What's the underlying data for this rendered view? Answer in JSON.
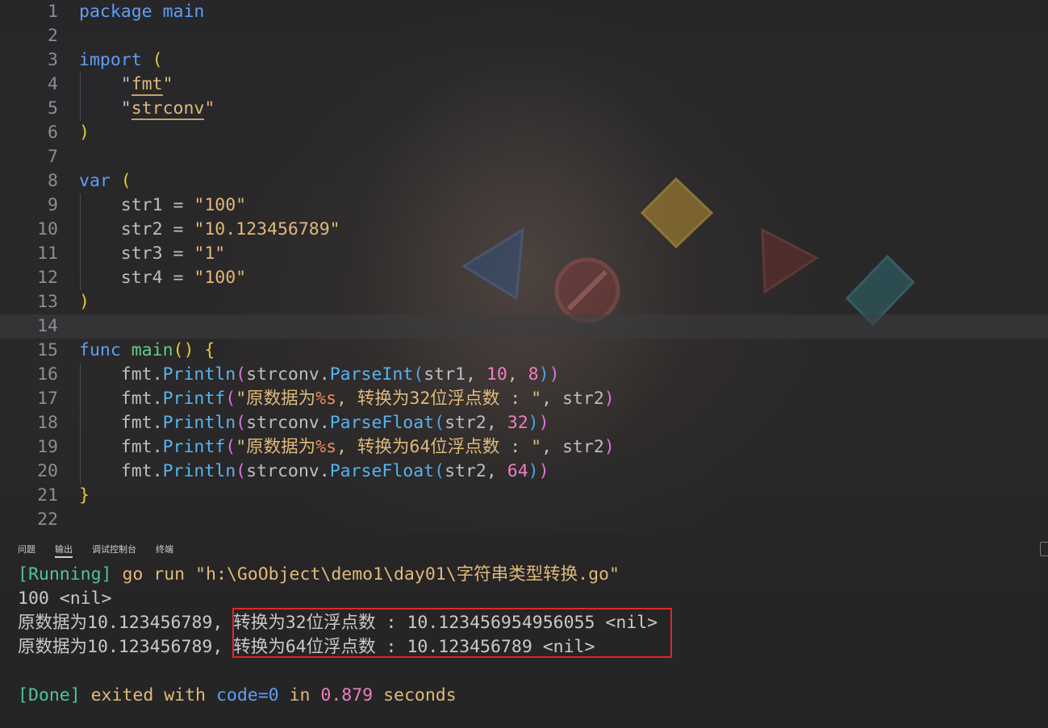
{
  "editor": {
    "lines": [
      {
        "n": "1",
        "tokens": [
          {
            "t": "package",
            "c": "kw"
          },
          {
            "t": " "
          },
          {
            "t": "main",
            "c": "kw"
          }
        ]
      },
      {
        "n": "2",
        "tokens": []
      },
      {
        "n": "3",
        "tokens": [
          {
            "t": "import",
            "c": "kw"
          },
          {
            "t": " "
          },
          {
            "t": "(",
            "c": "pl"
          }
        ]
      },
      {
        "n": "4",
        "tokens": [
          {
            "t": "    \""
          },
          {
            "t": "fmt",
            "c": "str ul"
          },
          {
            "t": "\"",
            "c": "str"
          }
        ]
      },
      {
        "n": "5",
        "tokens": [
          {
            "t": "    \""
          },
          {
            "t": "strconv",
            "c": "str ul"
          },
          {
            "t": "\"",
            "c": "str"
          }
        ]
      },
      {
        "n": "6",
        "tokens": [
          {
            "t": ")",
            "c": "pl"
          }
        ]
      },
      {
        "n": "7",
        "tokens": []
      },
      {
        "n": "8",
        "tokens": [
          {
            "t": "var",
            "c": "kw"
          },
          {
            "t": " "
          },
          {
            "t": "(",
            "c": "pl"
          }
        ]
      },
      {
        "n": "9",
        "tokens": [
          {
            "t": "    str1 = "
          },
          {
            "t": "\"100\"",
            "c": "str"
          }
        ]
      },
      {
        "n": "10",
        "tokens": [
          {
            "t": "    str2 = "
          },
          {
            "t": "\"10.123456789\"",
            "c": "str"
          }
        ]
      },
      {
        "n": "11",
        "tokens": [
          {
            "t": "    str3 = "
          },
          {
            "t": "\"1\"",
            "c": "str"
          }
        ]
      },
      {
        "n": "12",
        "tokens": [
          {
            "t": "    str4 = "
          },
          {
            "t": "\"100\"",
            "c": "str"
          }
        ]
      },
      {
        "n": "13",
        "tokens": [
          {
            "t": ")",
            "c": "pl"
          }
        ]
      },
      {
        "n": "14",
        "tokens": [],
        "current": true
      },
      {
        "n": "15",
        "tokens": [
          {
            "t": "func",
            "c": "kw"
          },
          {
            "t": " "
          },
          {
            "t": "main",
            "c": "fnd"
          },
          {
            "t": "()",
            "c": "pl"
          },
          {
            "t": " "
          },
          {
            "t": "{",
            "c": "pl"
          }
        ]
      },
      {
        "n": "16",
        "tokens": [
          {
            "t": "    fmt."
          },
          {
            "t": "Println",
            "c": "fn"
          },
          {
            "t": "(",
            "c": "pp"
          },
          {
            "t": "strconv."
          },
          {
            "t": "ParseInt",
            "c": "fn"
          },
          {
            "t": "(",
            "c": "pb"
          },
          {
            "t": "str1, "
          },
          {
            "t": "10",
            "c": "num"
          },
          {
            "t": ", "
          },
          {
            "t": "8",
            "c": "num"
          },
          {
            "t": ")",
            "c": "pb"
          },
          {
            "t": ")",
            "c": "pp"
          }
        ]
      },
      {
        "n": "17",
        "tokens": [
          {
            "t": "    fmt."
          },
          {
            "t": "Printf",
            "c": "fn"
          },
          {
            "t": "(",
            "c": "pp"
          },
          {
            "t": "\"原数据为",
            "c": "str"
          },
          {
            "t": "%s",
            "c": "fmt"
          },
          {
            "t": ", 转换为32位浮点数 : \"",
            "c": "str"
          },
          {
            "t": ", str2"
          },
          {
            "t": ")",
            "c": "pp"
          }
        ]
      },
      {
        "n": "18",
        "tokens": [
          {
            "t": "    fmt."
          },
          {
            "t": "Println",
            "c": "fn"
          },
          {
            "t": "(",
            "c": "pp"
          },
          {
            "t": "strconv."
          },
          {
            "t": "ParseFloat",
            "c": "fn"
          },
          {
            "t": "(",
            "c": "pb"
          },
          {
            "t": "str2, "
          },
          {
            "t": "32",
            "c": "num"
          },
          {
            "t": ")",
            "c": "pb"
          },
          {
            "t": ")",
            "c": "pp"
          }
        ]
      },
      {
        "n": "19",
        "tokens": [
          {
            "t": "    fmt."
          },
          {
            "t": "Printf",
            "c": "fn"
          },
          {
            "t": "(",
            "c": "pp"
          },
          {
            "t": "\"原数据为",
            "c": "str"
          },
          {
            "t": "%s",
            "c": "fmt"
          },
          {
            "t": ", 转换为64位浮点数 : \"",
            "c": "str"
          },
          {
            "t": ", str2"
          },
          {
            "t": ")",
            "c": "pp"
          }
        ]
      },
      {
        "n": "20",
        "tokens": [
          {
            "t": "    fmt."
          },
          {
            "t": "Println",
            "c": "fn"
          },
          {
            "t": "(",
            "c": "pp"
          },
          {
            "t": "strconv."
          },
          {
            "t": "ParseFloat",
            "c": "fn"
          },
          {
            "t": "(",
            "c": "pb"
          },
          {
            "t": "str2, "
          },
          {
            "t": "64",
            "c": "num"
          },
          {
            "t": ")",
            "c": "pb"
          },
          {
            "t": ")",
            "c": "pp"
          }
        ]
      },
      {
        "n": "21",
        "tokens": [
          {
            "t": "}",
            "c": "pl"
          }
        ]
      },
      {
        "n": "22",
        "tokens": []
      }
    ]
  },
  "panel": {
    "tabs": [
      {
        "label": "问题"
      },
      {
        "label": "输出",
        "active": true
      },
      {
        "label": "调试控制台"
      },
      {
        "label": "终端"
      }
    ],
    "output": [
      [
        {
          "t": "[Running]",
          "c": "o-green"
        },
        {
          "t": " go run \"h:\\GoObject\\demo1\\day01\\字符串类型转换.go\"",
          "c": "o-gold"
        }
      ],
      [
        {
          "t": "100 <nil>"
        }
      ],
      [
        {
          "t": "原数据为10.123456789, 转换为32位浮点数 : 10.123456954956055 <nil>"
        }
      ],
      [
        {
          "t": "原数据为10.123456789, 转换为64位浮点数 : 10.123456789 <nil>"
        }
      ],
      [],
      [
        {
          "t": "[Done]",
          "c": "o-green"
        },
        {
          "t": " exited with ",
          "c": "o-gold"
        },
        {
          "t": "code=0",
          "c": "o-blue"
        },
        {
          "t": " in ",
          "c": "o-gold"
        },
        {
          "t": "0.879",
          "c": "o-pink"
        },
        {
          "t": " seconds",
          "c": "o-gold"
        }
      ]
    ]
  },
  "colors": {
    "keyword": "#5f9ef5",
    "string": "#e0b97a",
    "number": "#ee7fc0",
    "highlight_box": "#e0262a"
  }
}
